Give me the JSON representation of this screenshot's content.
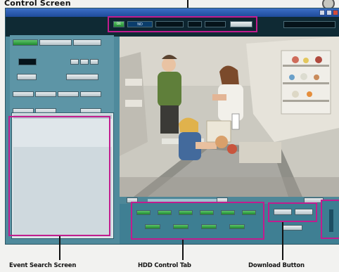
{
  "colors": {
    "highlight": "#c11c8e",
    "screen_bg": "#4f8a9c",
    "title_bar": "#1e4a9a",
    "status_dark": "#0d2530",
    "event_link": "#1f3a8a"
  },
  "header": {
    "caption": "Control Screen"
  },
  "window": {
    "title": ""
  },
  "status": {
    "mode_1": "DE",
    "mode_2": "ND",
    "field_1": "",
    "field_2": "",
    "clock": ""
  },
  "left_panel": {
    "tabs": [
      "",
      "",
      ""
    ],
    "buttons": [
      "",
      "",
      "",
      "",
      "",
      "",
      "",
      "",
      "",
      "",
      "",
      ""
    ]
  },
  "event_search": {
    "columns": [
      "",
      "",
      "",
      "",
      ""
    ],
    "rows": [
      [
        "",
        "",
        "",
        "",
        ""
      ],
      [
        "",
        "",
        "",
        "",
        ""
      ],
      [
        "",
        "",
        "",
        "",
        ""
      ],
      [
        "",
        "",
        "",
        "",
        ""
      ],
      [
        "",
        "",
        "",
        "",
        ""
      ],
      [
        "",
        "",
        "",
        "",
        ""
      ]
    ]
  },
  "hdd_control": {
    "buttons": [
      "",
      "",
      "",
      "",
      "",
      "",
      "",
      "",
      "",
      ""
    ]
  },
  "download": {
    "buttons": [
      "",
      ""
    ]
  },
  "callouts": {
    "event_search": "Event Search Screen",
    "hdd_control": "HDD Control Tab",
    "download": "Download Button"
  },
  "icons": {
    "minimize": "minimize-icon",
    "close": "close-icon",
    "side_panel": "side-tab-icon"
  }
}
